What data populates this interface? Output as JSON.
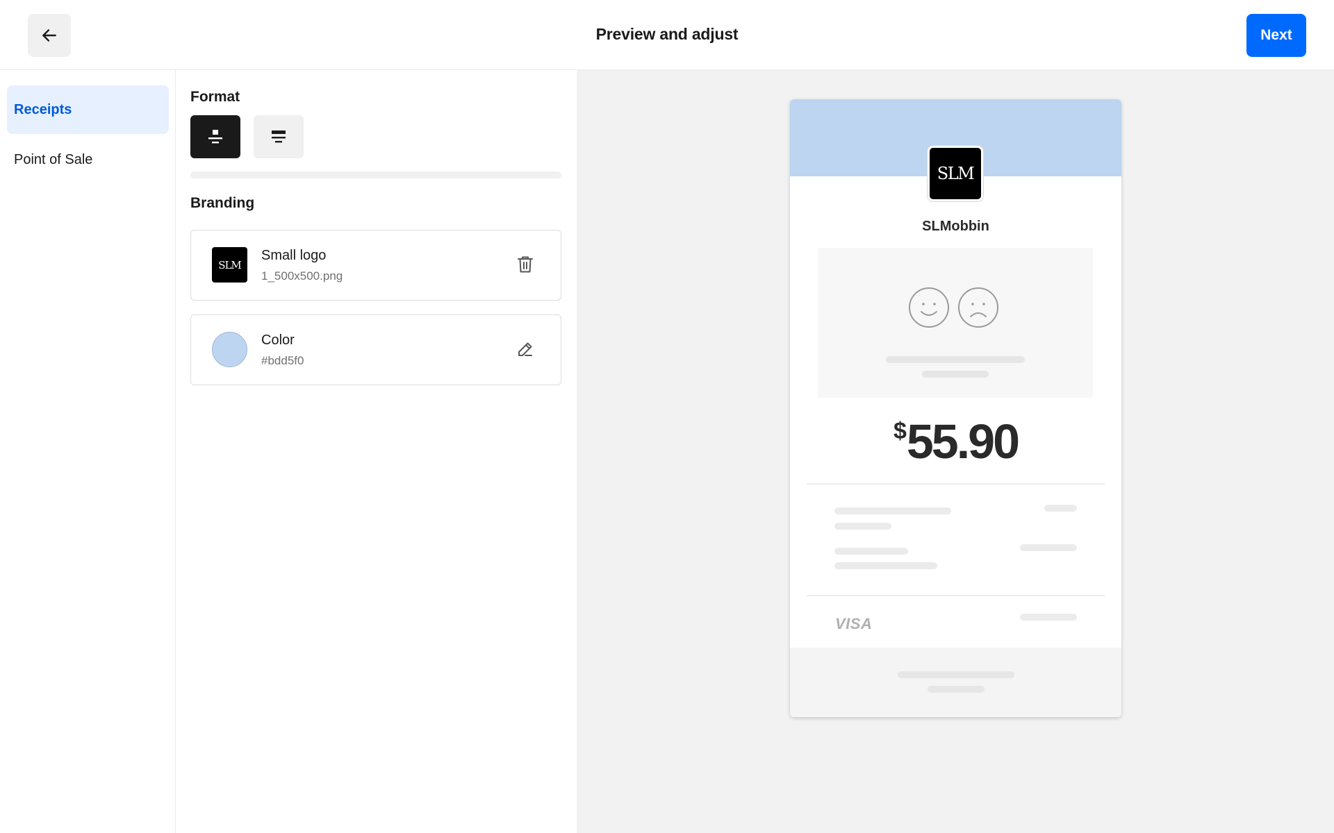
{
  "header": {
    "title": "Preview and adjust",
    "next_label": "Next",
    "back_icon": "arrow-left-icon"
  },
  "nav": {
    "items": [
      {
        "label": "Receipts",
        "active": true
      },
      {
        "label": "Point of Sale",
        "active": false
      }
    ]
  },
  "format": {
    "title": "Format",
    "options": [
      {
        "icon": "format-logo-top-icon",
        "selected": true
      },
      {
        "icon": "format-banner-icon",
        "selected": false
      }
    ]
  },
  "branding": {
    "title": "Branding",
    "logo": {
      "title": "Small logo",
      "filename": "1_500x500.png",
      "thumb_text": "SLM",
      "action_icon": "trash-icon"
    },
    "color": {
      "title": "Color",
      "value": "#bdd5f0",
      "action_icon": "pencil-icon"
    }
  },
  "receipt": {
    "business_name": "SLMobbin",
    "logo_text": "SLM",
    "currency_symbol": "$",
    "amount": "55.90",
    "card_brand": "VISA",
    "header_color": "#bdd5f0"
  },
  "colors": {
    "accent": "#006aff",
    "nav_active_bg": "#e6f0ff",
    "nav_active_text": "#005ad9",
    "preview_bg": "#f2f2f2"
  }
}
